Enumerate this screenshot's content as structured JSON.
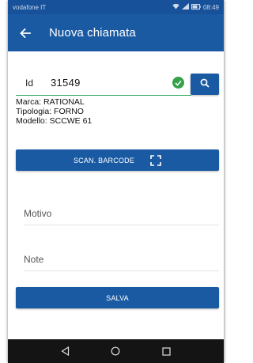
{
  "status_bar": {
    "carrier": "vodafone IT",
    "time": "08:49"
  },
  "app_bar": {
    "title": "Nuova chiamata",
    "back_icon": "arrow-left-icon"
  },
  "id_field": {
    "label": "Id",
    "value": "31549",
    "valid_icon": "check-circle-icon",
    "search_icon": "search-icon"
  },
  "device_info": {
    "marca": "Marca: RATIONAL",
    "tipologia": "Tipologia: FORNO",
    "modello": "Modello: SCCWE 61"
  },
  "scan_button": {
    "label": "SCAN. BARCODE",
    "icon": "scan-frame-icon"
  },
  "motivo_field": {
    "placeholder": "Motivo"
  },
  "note_field": {
    "placeholder": "Note"
  },
  "save_button": {
    "label": "SALVA"
  },
  "nav_bar": {
    "icons": [
      "back-triangle-icon",
      "home-circle-icon",
      "recents-square-icon"
    ]
  },
  "colors": {
    "primary": "#1a5aa3",
    "status_bar": "#17519a",
    "valid_green": "#35a24a",
    "nav_bar": "#141414"
  }
}
